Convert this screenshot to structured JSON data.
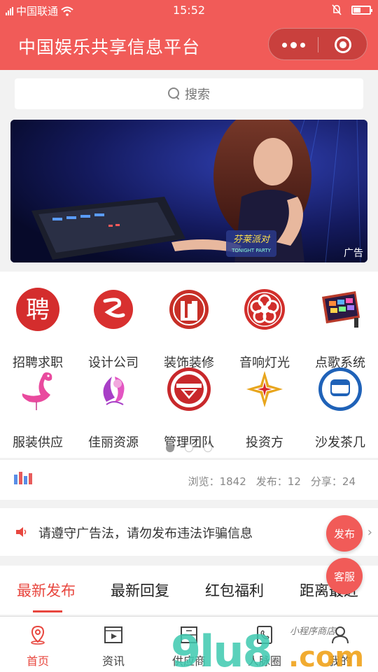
{
  "status_bar": {
    "carrier": "中国联通",
    "time": "15:52"
  },
  "nav": {
    "title": "中国娱乐共享信息平台"
  },
  "search": {
    "placeholder": "搜索"
  },
  "banner": {
    "tag": "广告",
    "logo_text_1": "芬莱派对",
    "logo_text_2": "TONIGHT PARTY"
  },
  "categories": [
    {
      "label": "招聘求职",
      "icon": "recruit-icon"
    },
    {
      "label": "设计公司",
      "icon": "design-icon"
    },
    {
      "label": "装饰装修",
      "icon": "decoration-icon"
    },
    {
      "label": "音响灯光",
      "icon": "audio-light-icon"
    },
    {
      "label": "点歌系统",
      "icon": "karaoke-icon"
    },
    {
      "label": "服装供应",
      "icon": "flamingo-icon"
    },
    {
      "label": "佳丽资源",
      "icon": "beauty-icon"
    },
    {
      "label": "管理团队",
      "icon": "management-icon"
    },
    {
      "label": "投资方",
      "icon": "investor-icon"
    },
    {
      "label": "沙发茶几",
      "icon": "sofa-icon"
    }
  ],
  "pager": {
    "pages": 3,
    "active": 0
  },
  "stats": {
    "views_label": "浏览：",
    "views": "1842",
    "posts_label": "发布：",
    "posts": "12",
    "shares_label": "分享：",
    "shares": "24"
  },
  "notice": {
    "text": "请遵守广告法，请勿发布违法诈骗信息"
  },
  "fabs": {
    "publish": "发布",
    "service": "客服"
  },
  "tabs": [
    "最新发布",
    "最新回复",
    "红包福利",
    "距离最近"
  ],
  "tabbar": [
    {
      "label": "首页",
      "icon": "home-location-icon",
      "active": true
    },
    {
      "label": "资讯",
      "icon": "news-icon",
      "active": false
    },
    {
      "label": "供应商",
      "icon": "supplier-icon",
      "active": false
    },
    {
      "label": "人脉圈",
      "icon": "network-icon",
      "active": false
    },
    {
      "label": "我的",
      "icon": "user-icon",
      "active": false
    }
  ],
  "watermark": {
    "text": "9lu8.com",
    "sub": "小程序商店"
  },
  "colors": {
    "brand": "#f15b58",
    "accent": "#e8473f"
  }
}
